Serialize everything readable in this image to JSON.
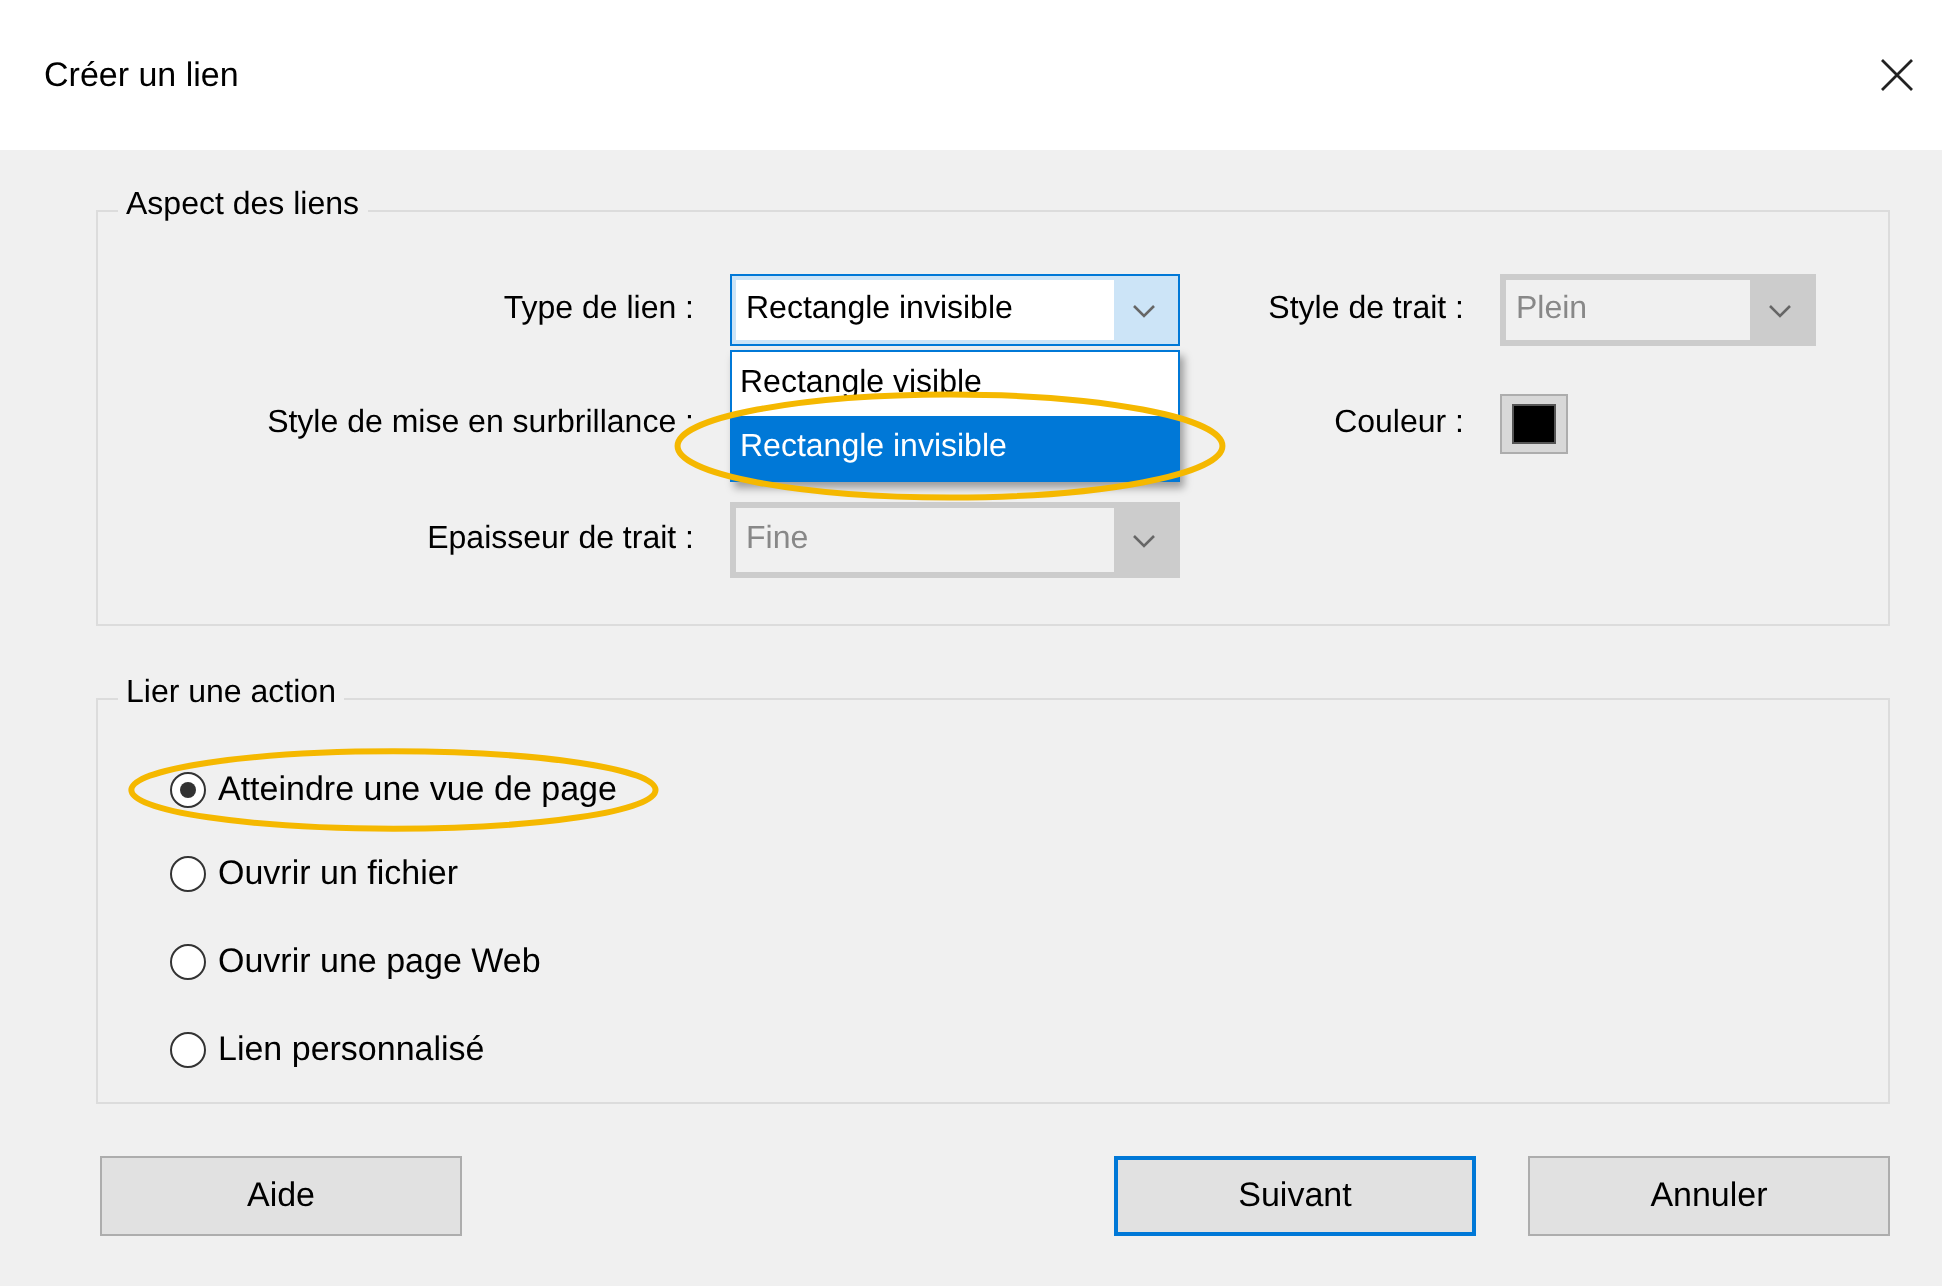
{
  "window": {
    "title": "Créer un lien"
  },
  "appearance": {
    "title": "Aspect des liens",
    "link_type": {
      "label": "Type de lien :",
      "value": "Rectangle invisible",
      "expanded": true,
      "options": [
        {
          "label": "Rectangle visible",
          "selected": false,
          "circled": false
        },
        {
          "label": "Rectangle invisible",
          "selected": true,
          "circled": true
        }
      ]
    },
    "highlight_style": {
      "label": "Style de mise en surbrillance :"
    },
    "line_width": {
      "label": "Epaisseur de trait :",
      "value": "Fine",
      "disabled": true
    },
    "line_style": {
      "label": "Style de trait :",
      "value": "Plein",
      "disabled": true
    },
    "color": {
      "label": "Couleur :",
      "color": "#000000"
    }
  },
  "action": {
    "title": "Lier une action",
    "options": [
      {
        "label": "Atteindre une vue de page",
        "selected": true,
        "circled": true
      },
      {
        "label": "Ouvrir un fichier",
        "selected": false,
        "circled": false
      },
      {
        "label": "Ouvrir une page Web",
        "selected": false,
        "circled": false
      },
      {
        "label": "Lien personnalisé",
        "selected": false,
        "circled": false
      }
    ]
  },
  "buttons": [
    {
      "label": "Aide",
      "default": false
    },
    {
      "label": "Suivant",
      "default": true
    },
    {
      "label": "Annuler",
      "default": false
    }
  ]
}
